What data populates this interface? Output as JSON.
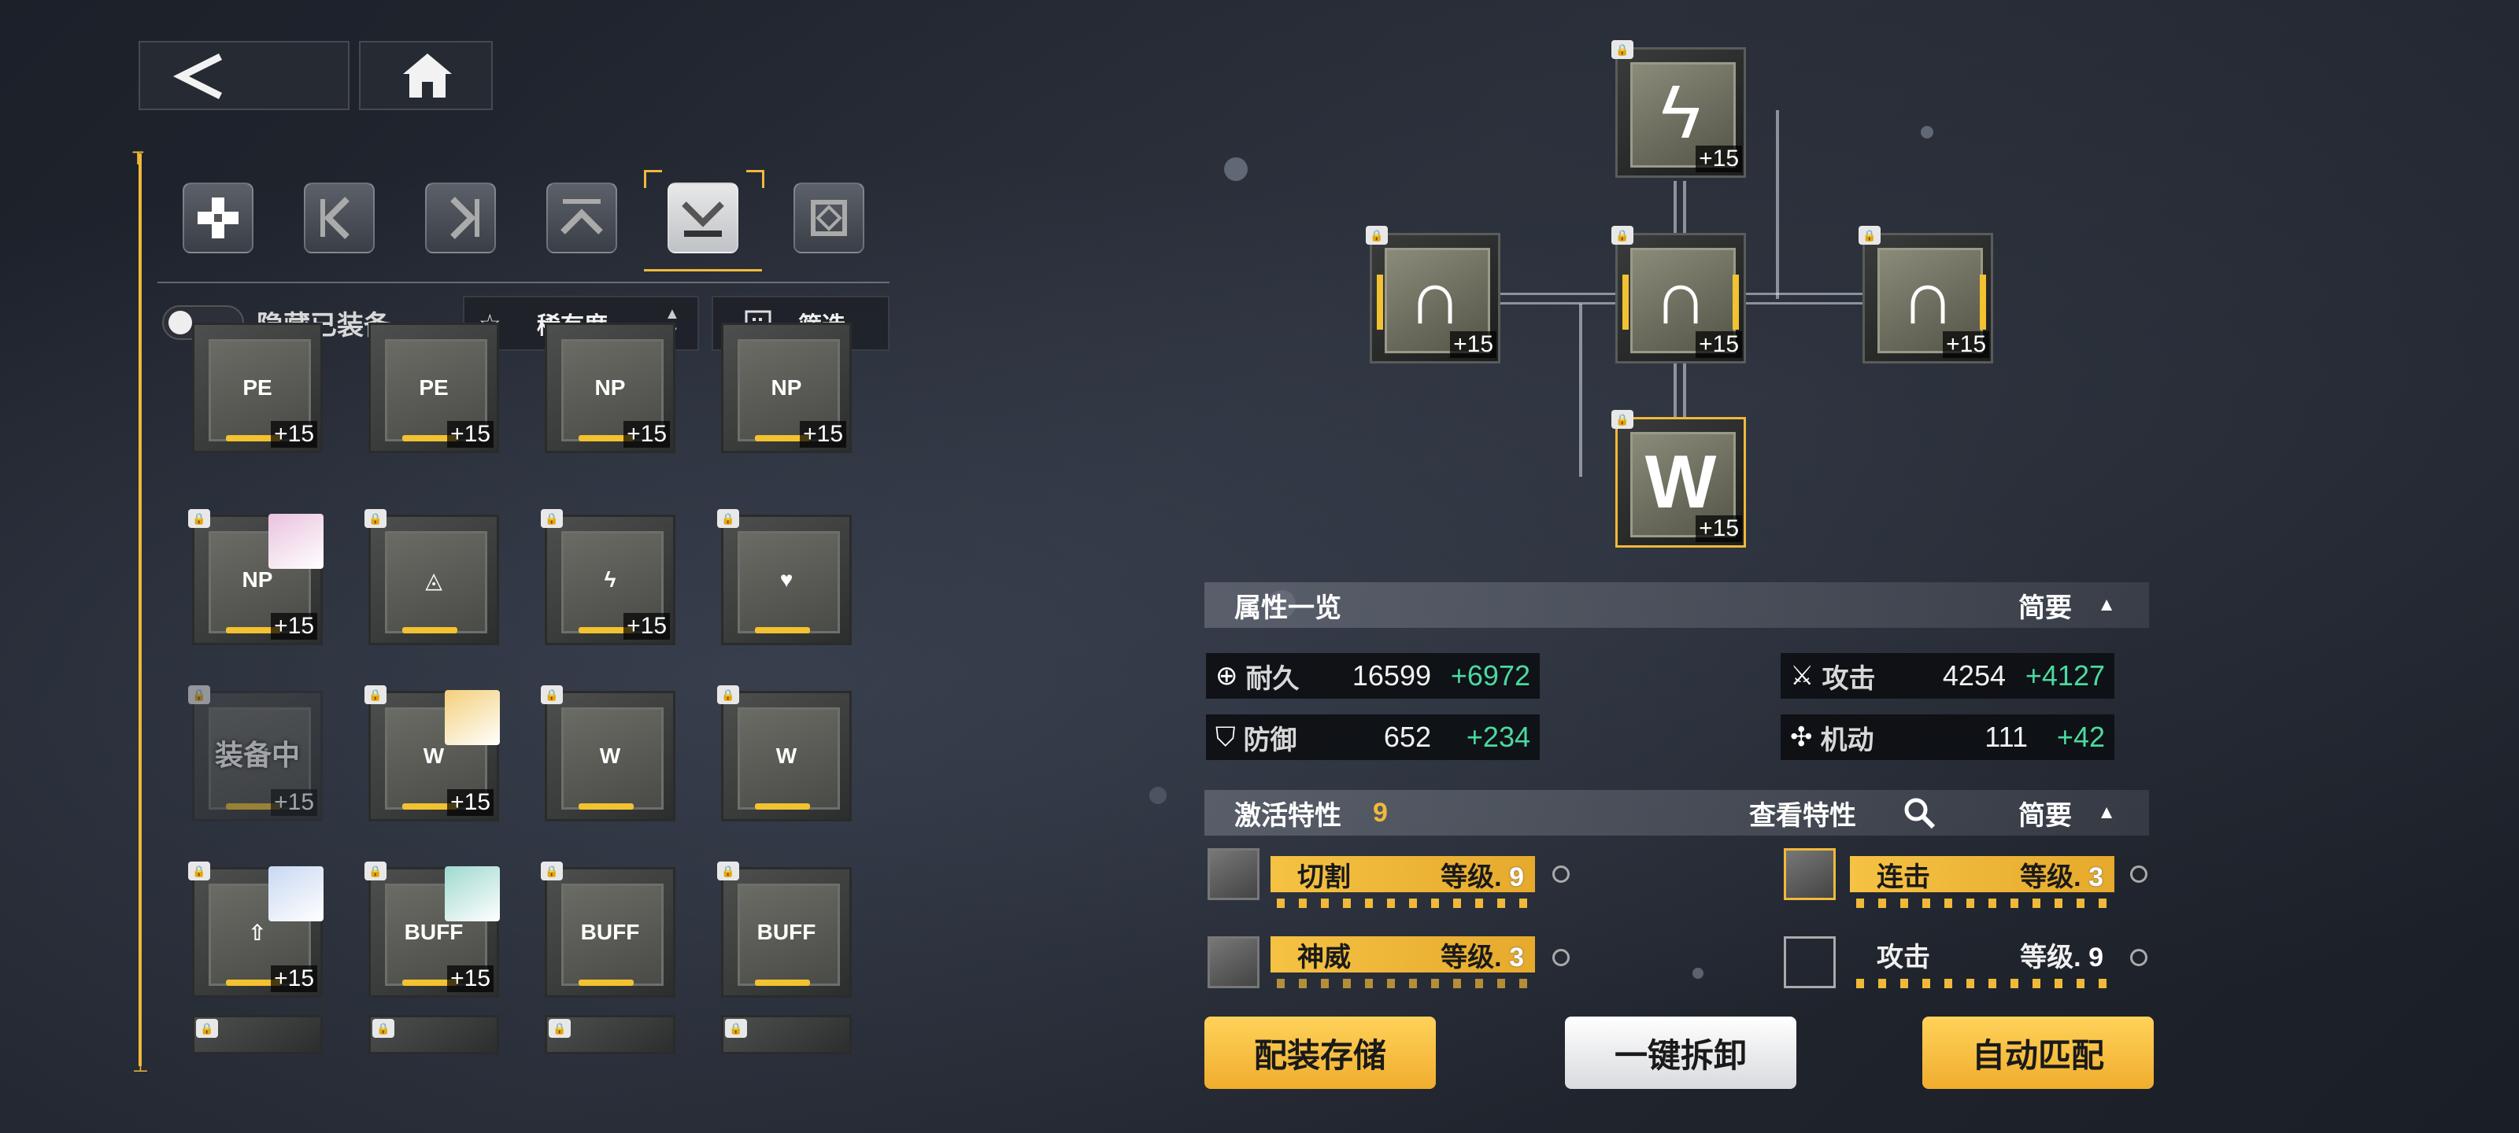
{
  "nav": {
    "back_icon": "chevron-left-icon",
    "home_icon": "home-icon"
  },
  "scrollbar": {
    "top_marker": "T",
    "bottom_marker": "⊥"
  },
  "tabs": [
    {
      "name": "all",
      "icon": "plus-cross-icon",
      "active": false
    },
    {
      "name": "left",
      "icon": "bracket-left-icon",
      "active": false
    },
    {
      "name": "right",
      "icon": "bracket-right-icon",
      "active": false
    },
    {
      "name": "top",
      "icon": "chevron-up-icon",
      "active": false
    },
    {
      "name": "bottom",
      "icon": "chevron-down-icon",
      "active": true
    },
    {
      "name": "center",
      "icon": "frame-icon",
      "active": false
    }
  ],
  "controls": {
    "hide_equipped_label": "隐藏已装备",
    "hide_equipped_on": false,
    "sort_label": "稀有度",
    "filter_label": "筛选"
  },
  "inventory": [
    {
      "glyph": "PE",
      "plus": "+15",
      "portrait": false
    },
    {
      "glyph": "PE",
      "plus": "+15",
      "portrait": false
    },
    {
      "glyph": "NP",
      "plus": "+15",
      "portrait": false
    },
    {
      "glyph": "NP",
      "plus": "+15",
      "portrait": false
    },
    {
      "glyph": "NP",
      "plus": "+15",
      "portrait": true
    },
    {
      "glyph": "◬",
      "plus": "",
      "portrait": false
    },
    {
      "glyph": "ϟ",
      "plus": "+15",
      "portrait": false
    },
    {
      "glyph": "♥",
      "plus": "",
      "portrait": false
    },
    {
      "glyph": "W",
      "plus": "+15",
      "portrait": false,
      "equipped": "装备中"
    },
    {
      "glyph": "W",
      "plus": "+15",
      "portrait": true
    },
    {
      "glyph": "W",
      "plus": "",
      "portrait": false
    },
    {
      "glyph": "W",
      "plus": "",
      "portrait": false
    },
    {
      "glyph": "⇧",
      "plus": "+15",
      "portrait": true
    },
    {
      "glyph": "BUFF",
      "plus": "+15",
      "portrait": true
    },
    {
      "glyph": "BUFF",
      "plus": "",
      "portrait": false
    },
    {
      "glyph": "BUFF",
      "plus": "",
      "portrait": false
    }
  ],
  "tree": {
    "top": {
      "glyph": "ϟ",
      "plus": "+15"
    },
    "left": {
      "glyph": "∩",
      "plus": "+15"
    },
    "center": {
      "glyph": "∩",
      "plus": "+15"
    },
    "right": {
      "glyph": "∩",
      "plus": "+15"
    },
    "bottom": {
      "glyph": "W",
      "plus": "+15"
    }
  },
  "attributes": {
    "title": "属性一览",
    "toggle_label": "简要",
    "stats": [
      {
        "icon": "durability-icon",
        "label": "耐久",
        "value": "16599",
        "bonus": "+6972"
      },
      {
        "icon": "attack-icon",
        "label": "攻击",
        "value": "4254",
        "bonus": "+4127"
      },
      {
        "icon": "shield-icon",
        "label": "防御",
        "value": "652",
        "bonus": "+234"
      },
      {
        "icon": "mobility-icon",
        "label": "机动",
        "value": "111",
        "bonus": "+42"
      }
    ]
  },
  "traits": {
    "title": "激活特性",
    "count": "9",
    "view_label": "查看特性",
    "toggle_label": "简要",
    "items": [
      {
        "name": "切割",
        "level_label": "等级.",
        "level": "9",
        "style": "gold"
      },
      {
        "name": "连击",
        "level_label": "等级.",
        "level": "3",
        "style": "gold"
      },
      {
        "name": "神威",
        "level_label": "等级.",
        "level": "3",
        "style": "gold"
      },
      {
        "name": "攻击",
        "level_label": "等级.",
        "level": "9",
        "style": "dark"
      }
    ]
  },
  "buttons": {
    "save": "配装存储",
    "unequip": "一键拆卸",
    "auto": "自动匹配"
  },
  "colors": {
    "accent": "#f0b93a",
    "bonus": "#4bd9a0"
  }
}
